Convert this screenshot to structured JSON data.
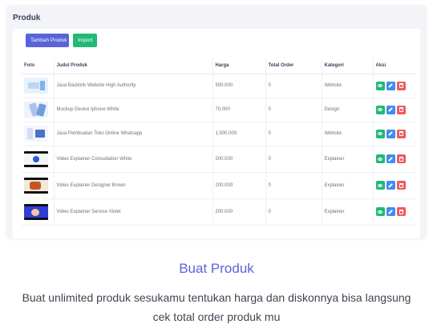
{
  "panel": {
    "title": "Produk",
    "add_button": "Tambah Produk",
    "import_button": "Import"
  },
  "table": {
    "headers": [
      "Foto",
      "Judul Produk",
      "Harga",
      "Total Order",
      "Kategori",
      "Aksi"
    ],
    "rows": [
      {
        "title": "Jasa Backlink Website High Authority",
        "price": "500.000",
        "orders": "0",
        "category": "Website",
        "thumb": "banner"
      },
      {
        "title": "Mockup Device Iphone White",
        "price": "70.000",
        "orders": "0",
        "category": "Design",
        "thumb": "phone-mockup"
      },
      {
        "title": "Jasa Pembuatan Toko Online Whatsapp",
        "price": "1.500.000",
        "orders": "0",
        "category": "Website",
        "thumb": "shop"
      },
      {
        "title": "Video Explainer Consultation White",
        "price": "200.000",
        "orders": "0",
        "category": "Explainer",
        "thumb": "video-white"
      },
      {
        "title": "Video Explainer Designer Brown",
        "price": "200.000",
        "orders": "0",
        "category": "Explainer",
        "thumb": "video-brown"
      },
      {
        "title": "Video Explainer Service Violet",
        "price": "200.000",
        "orders": "0",
        "category": "Explainer",
        "thumb": "video-violet"
      }
    ]
  },
  "feature": {
    "heading": "Buat Produk",
    "description": "Buat unlimited produk sesukamu tentukan harga dan diskonnya bisa langsung cek total order produk mu"
  },
  "colors": {
    "primary_button": "#5864d8",
    "success_button": "#22b876",
    "edit_button": "#3d8df5",
    "delete_button": "#ee5a5a",
    "heading": "#5a63d8"
  },
  "icons": {
    "view": "eye-icon",
    "edit": "pencil-icon",
    "delete": "trash-icon"
  }
}
